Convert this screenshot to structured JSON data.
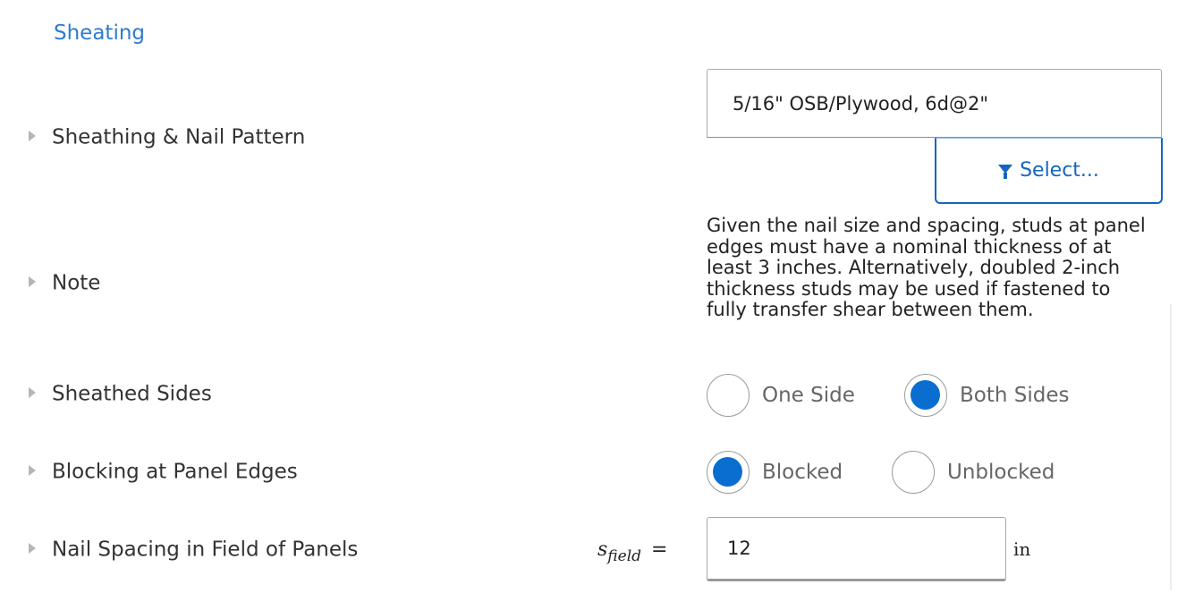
{
  "section": {
    "title": "Sheating"
  },
  "rows": {
    "sheathing": {
      "label": "Sheathing & Nail Pattern",
      "value": "5/16\" OSB/Plywood, 6d@2\"",
      "select_label": "Select..."
    },
    "note": {
      "label": "Note",
      "text": "Given the nail size and spacing, studs at panel edges must have a nominal thickness of at least 3 inches. Alternatively, doubled 2-inch thickness studs may be used if fastened to fully transfer shear between them."
    },
    "sheathed_sides": {
      "label": "Sheathed Sides",
      "options": [
        "One Side",
        "Both Sides"
      ],
      "selected": "Both Sides"
    },
    "blocking": {
      "label": "Blocking at Panel Edges",
      "options": [
        "Blocked",
        "Unblocked"
      ],
      "selected": "Blocked"
    },
    "nail_spacing": {
      "label": "Nail Spacing in Field of Panels",
      "symbol": "s",
      "symbol_sub": "field",
      "equals": "=",
      "value": "12",
      "unit": "in"
    }
  },
  "colors": {
    "accent": "#0a6ed1",
    "link": "#2e7ccf",
    "text": "#333333"
  },
  "icons": {
    "row_caret": "caret-right-icon",
    "filter": "filter-icon"
  }
}
